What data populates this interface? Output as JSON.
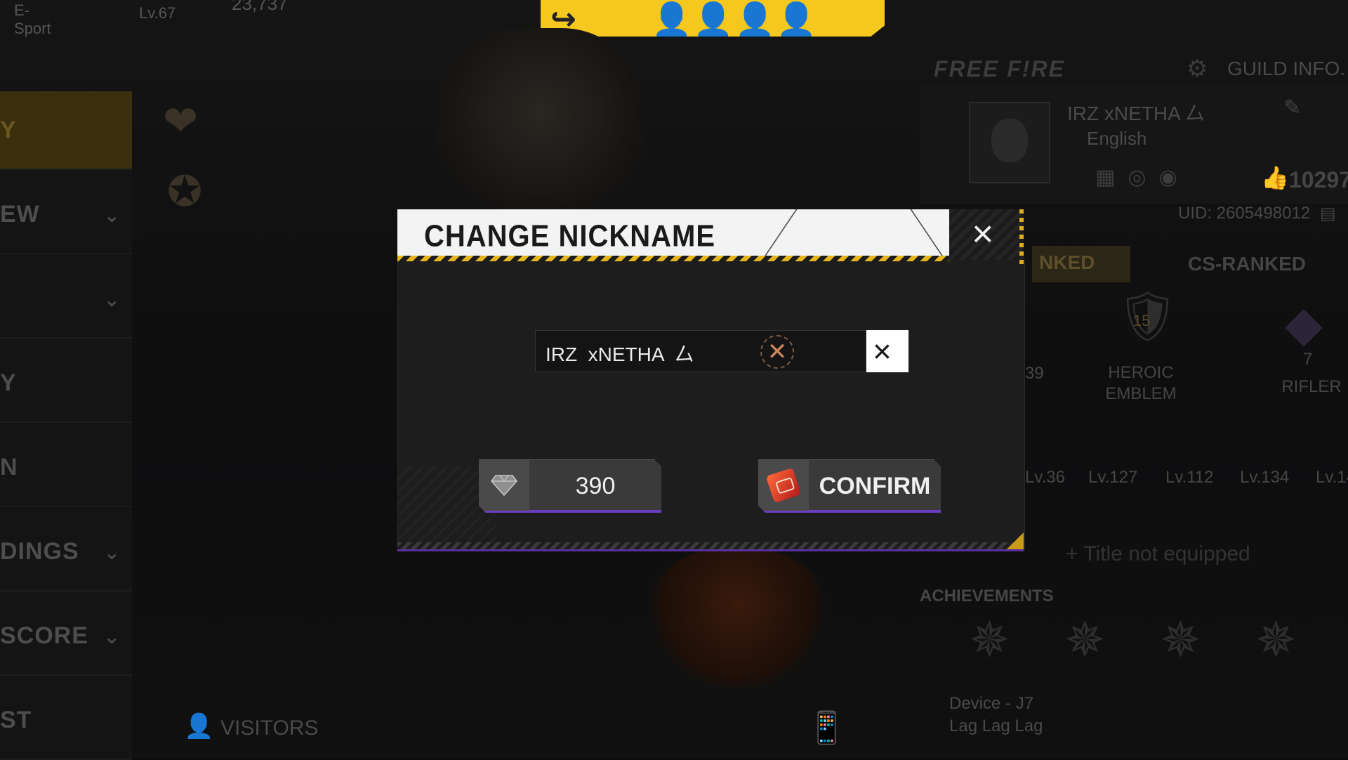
{
  "background": {
    "top_left_label": "E-Sport",
    "top_left_level": "Lv.67",
    "top_left_stats": "23,737",
    "rail_items": [
      {
        "label": "Y",
        "chevron": false,
        "active": true
      },
      {
        "label": "EW",
        "chevron": true
      },
      {
        "label": "",
        "chevron": true
      },
      {
        "label": "Y",
        "chevron": false
      },
      {
        "label": "N",
        "chevron": false
      },
      {
        "label": "DINGS",
        "chevron": true
      },
      {
        "label": "SCORE",
        "chevron": true
      },
      {
        "label": "ST",
        "chevron": false
      }
    ],
    "visitors_label": "VISITORS",
    "profile": {
      "logo": "FREE F!RE",
      "guild_info": "GUILD INFO.",
      "name": "IRZ  xNETHA  厶",
      "language": "English",
      "likes": "10297",
      "uid": "UID: 2605498012",
      "tab_ranked": "NKED",
      "tab_cs_ranked": "CS-RANKED",
      "badges": [
        {
          "label": "HEROIC\nEMBLEM",
          "number": "15"
        },
        {
          "label": "RIFLER",
          "number": "7"
        }
      ],
      "partial_level": "39",
      "levels": [
        "Lv.36",
        "Lv.127",
        "Lv.112",
        "Lv.134",
        "Lv.14"
      ],
      "title_not_equipped": "+ Title not equipped",
      "achievements_label": "ACHIEVEMENTS",
      "device_line1": "Device - J7",
      "device_line2": "Lag Lag Lag"
    }
  },
  "modal": {
    "title": "CHANGE NICKNAME",
    "close_icon": "×",
    "nickname_value": "IRZ  xNETHA  厶",
    "clear_icon": "×",
    "price_value": "390",
    "price_icon": "diamond-icon",
    "confirm_label": "CONFIRM",
    "confirm_icon": "name-change-card-icon"
  },
  "colors": {
    "accent_yellow": "#f4c81e",
    "button_underline_purple": "#6b3dc0",
    "header_bg": "#f3f3f3"
  }
}
